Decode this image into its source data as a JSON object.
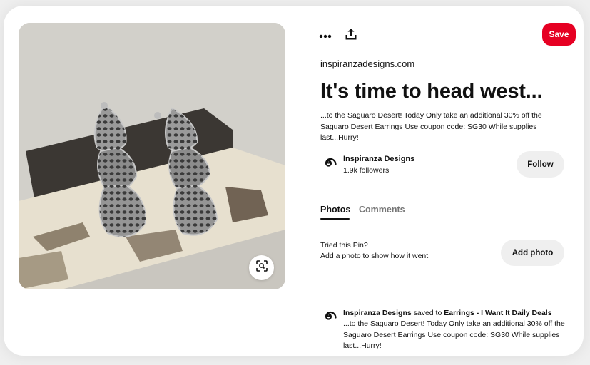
{
  "pin": {
    "source_link": "inspiranzadesigns.com",
    "title": "It's time to head west...",
    "description": "...to the Saguaro Desert! Today Only take an additional 30% off the Saguaro Desert Earrings Use coupon code: SG30 While supplies last...Hurry!",
    "save_label": "Save"
  },
  "actions": {
    "more_icon": "more-horizontal-icon",
    "share_icon": "share-upload-icon",
    "lens_icon": "visual-search-icon"
  },
  "creator": {
    "name": "Inspiranza Designs",
    "followers": "1.9k followers",
    "follow_label": "Follow"
  },
  "tabs": [
    {
      "label": "Photos",
      "active": true
    },
    {
      "label": "Comments",
      "active": false
    }
  ],
  "tried": {
    "line1": "Tried this Pin?",
    "line2": "Add a photo to show how it went",
    "button_label": "Add photo"
  },
  "activity": {
    "user": "Inspiranza Designs",
    "verb": "saved to",
    "board": "Earrings - I Want It Daily Deals",
    "text": "...to the Saguaro Desert! Today Only take an additional 30% off the Saguaro Desert Earrings Use coupon code: SG30 While supplies last...Hurry!"
  },
  "colors": {
    "save_red": "#e60023",
    "button_gray": "#efefef",
    "muted_text": "#767676"
  }
}
